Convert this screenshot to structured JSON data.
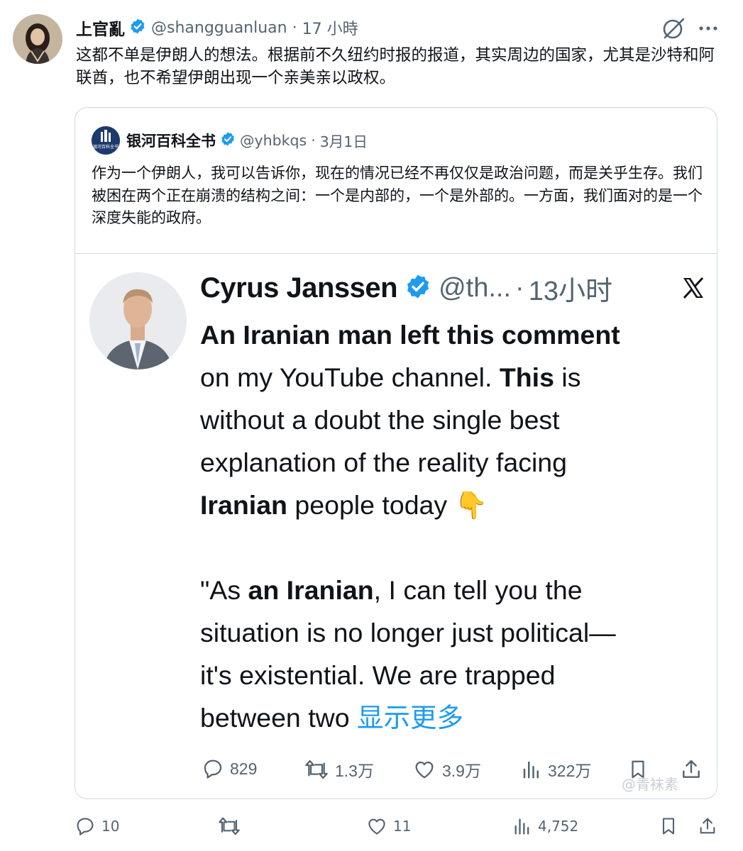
{
  "post": {
    "author_name": "上官亂",
    "handle": "@shangguanluan",
    "separator": "·",
    "time": "17 小時",
    "text": "这都不单是伊朗人的想法。根据前不久纽约时报的报道，其实周边的国家，尤其是沙特和阿联酋，也不希望伊朗出现一个亲美亲以政权。",
    "icons": [
      "verified-badge-icon",
      "grok-icon",
      "more-icon"
    ]
  },
  "quote": {
    "author_name": "银河百科全书",
    "avatar_text": "银河百科全书",
    "handle": "@yhbkqs",
    "separator": "·",
    "date": "3月1日",
    "text": "作为一个伊朗人，我可以告诉你，现在的情况已经不再仅仅是政治问题，而是关乎生存。我们被困在两个正在崩溃的结构之间：一个是内部的，一个是外部的。一方面，我们面对的是一个深度失能的政府。"
  },
  "embedded": {
    "author_name": "Cyrus Janssen",
    "handle": "@th...",
    "separator": "·",
    "time": "13小时",
    "lines": [
      [
        {
          "text": "An Iranian man left this comment",
          "bold": true
        }
      ],
      [
        {
          "text": "on my YouTube channel. ",
          "bold": false
        },
        {
          "text": "This",
          "bold": true
        },
        {
          "text": " is",
          "bold": false
        }
      ],
      [
        {
          "text": "without a doubt the single best",
          "bold": false
        }
      ],
      [
        {
          "text": "explanation of the reality facing",
          "bold": false
        }
      ],
      [
        {
          "text": "Iranian",
          "bold": true
        },
        {
          "text": " people today ",
          "bold": false
        },
        {
          "text": "👇",
          "bold": false
        }
      ],
      [],
      [
        {
          "text": "\"As ",
          "bold": false
        },
        {
          "text": "an Iranian",
          "bold": true
        },
        {
          "text": ", I can tell you the",
          "bold": false
        }
      ],
      [
        {
          "text": "situation is no longer just political—",
          "bold": false
        }
      ],
      [
        {
          "text": "it's existential. We are trapped",
          "bold": false
        }
      ],
      [
        {
          "text": "between two ",
          "bold": false
        }
      ]
    ],
    "show_more": "显示更多",
    "actions": {
      "replies": "829",
      "reposts": "1.3万",
      "likes": "3.9万",
      "views": "322万"
    },
    "watermark": "@青袜素",
    "icons": [
      "verified-badge-icon",
      "x-logo-icon",
      "reply-icon",
      "repost-icon",
      "like-icon",
      "views-icon",
      "bookmark-icon",
      "share-icon"
    ]
  },
  "actions": {
    "replies": "10",
    "reposts": "",
    "likes": "11",
    "views": "4,752",
    "icons": [
      "reply-icon",
      "repost-icon",
      "like-icon",
      "views-icon",
      "bookmark-icon",
      "share-icon"
    ]
  },
  "colors": {
    "text": "#0f1419",
    "muted": "#536471",
    "verified": "#1d9bf0",
    "link": "#1d9bf0",
    "border": "#cfd9de"
  }
}
